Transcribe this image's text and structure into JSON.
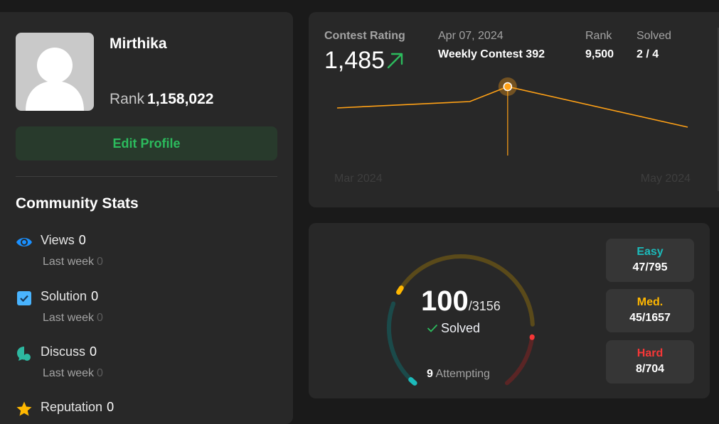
{
  "profile": {
    "username": "Mirthika",
    "rank_label": "Rank",
    "rank_value": "1,158,022",
    "edit_button": "Edit Profile"
  },
  "community": {
    "title": "Community Stats",
    "stats": [
      {
        "label": "Views",
        "value": "0",
        "week_label": "Last week",
        "week_value": "0",
        "icon": "eye-icon",
        "color": "#1a90ff"
      },
      {
        "label": "Solution",
        "value": "0",
        "week_label": "Last week",
        "week_value": "0",
        "icon": "checkbox-icon",
        "color": "#49b4ff"
      },
      {
        "label": "Discuss",
        "value": "0",
        "week_label": "Last week",
        "week_value": "0",
        "icon": "chat-bubble-icon",
        "color": "#2db8a0"
      },
      {
        "label": "Reputation",
        "value": "0",
        "icon": "star-icon",
        "color": "#ffb800"
      }
    ]
  },
  "contest": {
    "rating_label": "Contest Rating",
    "rating_value": "1,485",
    "date": "Apr 07, 2024",
    "contest_name": "Weekly Contest 392",
    "rank_label": "Rank",
    "rank_value": "9,500",
    "solved_label": "Solved",
    "solved_value": "2 / 4",
    "trend_icon": "arrow-up-right-icon",
    "line_color": "#ffa116",
    "chart_data": {
      "type": "line",
      "x_ticks": [
        "Mar 2024",
        "May 2024"
      ],
      "series": [
        {
          "values": [
            {
              "x": "2024-03-02",
              "y": 1475
            },
            {
              "x": "2024-03-30",
              "y": 1478
            },
            {
              "x": "2024-04-07",
              "y": 1485
            },
            {
              "x": "2024-05-15",
              "y": 1466
            }
          ]
        }
      ],
      "highlighted_index": 2,
      "ylim": [
        1455,
        1495
      ],
      "grid": false
    }
  },
  "progress": {
    "solved": "100",
    "total": "/3156",
    "solved_label": "Solved",
    "attempting_count": "9",
    "attempting_label": "Attempting",
    "difficulties": [
      {
        "name": "Easy",
        "count": "47/795",
        "color": "#1cbaba",
        "solved": 47,
        "total": 795
      },
      {
        "name": "Med.",
        "count": "45/1657",
        "color": "#ffb700",
        "solved": 45,
        "total": 1657
      },
      {
        "name": "Hard",
        "count": "8/704",
        "color": "#f63737",
        "solved": 8,
        "total": 704
      }
    ]
  }
}
